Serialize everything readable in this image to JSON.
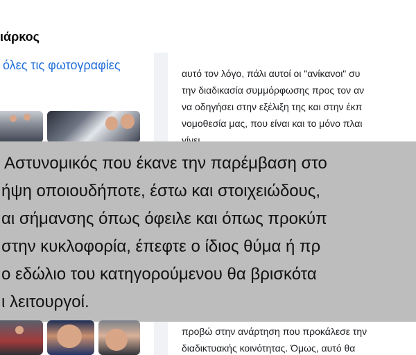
{
  "header": {
    "name_fragment": "ιάρκος"
  },
  "photos_panel": {
    "all_photos_link": "όλες τις φωτογραφίες"
  },
  "post": {
    "lines": [
      "αυτό τον λόγο, πάλι αυτοί οι \"ανίκανοι\" συ",
      "την διαδικασία συμμόρφωσης προς τον αν",
      "να οδηγήσει στην εξέλιξη της και στην έκπ",
      "νομοθεσία μας,  που είναι και το μόνο πλαι",
      "γίνει."
    ],
    "lower_lines": [
      "προβώ στην ανάρτηση που προκάλεσε την",
      "διαδικτυακής κοινότητας. Όμως, αυτό θα"
    ]
  },
  "overlay": {
    "lines": [
      "Αστυνομικός που έκανε την παρέμβαση στο",
      "ήψη οποιουδήποτε, έστω και στοιχειώδους,",
      "αι σήμανσης όπως όφειλε και όπως προκύπ",
      "στην κυκλοφορία, έπεφτε ο ίδιος θύμα ή πρ",
      "ο εδώλιο του κατηγορούμενου θα βρισκότα",
      "ι λειτουργοί."
    ]
  },
  "colors": {
    "link": "#216fdb",
    "overlay_bg": "#bdbdbd",
    "page_bg": "#f0f2f5"
  }
}
